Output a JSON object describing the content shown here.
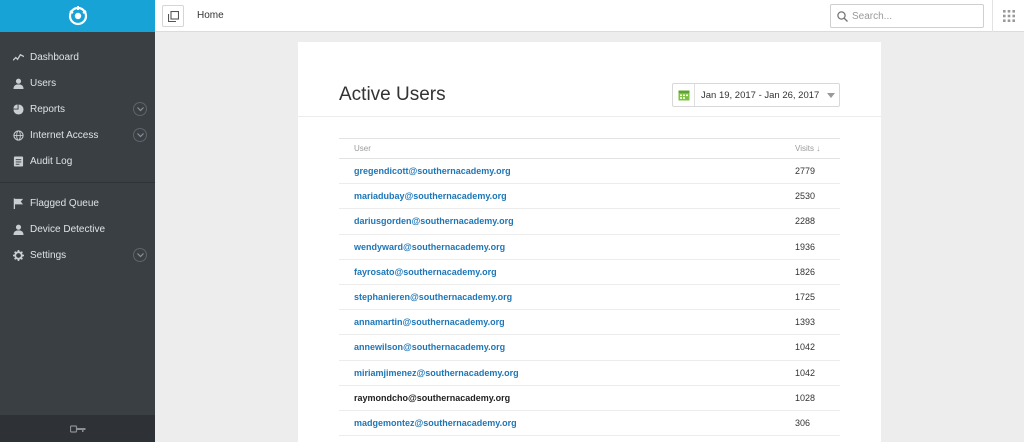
{
  "sidebar": {
    "items": [
      {
        "label": "Dashboard",
        "icon": "line-chart-icon"
      },
      {
        "label": "Users",
        "icon": "user-icon"
      },
      {
        "label": "Reports",
        "icon": "pie-chart-icon",
        "expandable": true
      },
      {
        "label": "Internet Access",
        "icon": "globe-icon",
        "expandable": true
      },
      {
        "label": "Audit Log",
        "icon": "log-icon"
      }
    ],
    "items2": [
      {
        "label": "Flagged Queue",
        "icon": "flag-icon"
      },
      {
        "label": "Device Detective",
        "icon": "user-icon"
      },
      {
        "label": "Settings",
        "icon": "gear-icon",
        "expandable": true
      }
    ]
  },
  "topbar": {
    "breadcrumb": "Home",
    "search_placeholder": "Search..."
  },
  "main": {
    "title": "Active Users",
    "date_range": "Jan 19, 2017 - Jan 26, 2017",
    "table": {
      "headers": {
        "user": "User",
        "visits": "Visits ↓"
      },
      "rows": [
        {
          "user": "gregendicott@southernacademy.org",
          "visits": "2779",
          "link": true
        },
        {
          "user": "mariadubay@southernacademy.org",
          "visits": "2530",
          "link": true
        },
        {
          "user": "dariusgorden@southernacademy.org",
          "visits": "2288",
          "link": true
        },
        {
          "user": "wendyward@southernacademy.org",
          "visits": "1936",
          "link": true
        },
        {
          "user": "fayrosato@southernacademy.org",
          "visits": "1826",
          "link": true
        },
        {
          "user": "stephanieren@southernacademy.org",
          "visits": "1725",
          "link": true
        },
        {
          "user": "annamartin@southernacademy.org",
          "visits": "1393",
          "link": true
        },
        {
          "user": "annewilson@southernacademy.org",
          "visits": "1042",
          "link": true
        },
        {
          "user": "miriamjimenez@southernacademy.org",
          "visits": "1042",
          "link": true
        },
        {
          "user": "raymondcho@southernacademy.org",
          "visits": "1028",
          "link": false
        },
        {
          "user": "madgemontez@southernacademy.org",
          "visits": "306",
          "link": true
        }
      ]
    }
  },
  "colors": {
    "brand": "#17a3d6",
    "sidebar_bg": "#3a3f44",
    "link": "#1d76b8",
    "calendar": "#7cc142"
  }
}
